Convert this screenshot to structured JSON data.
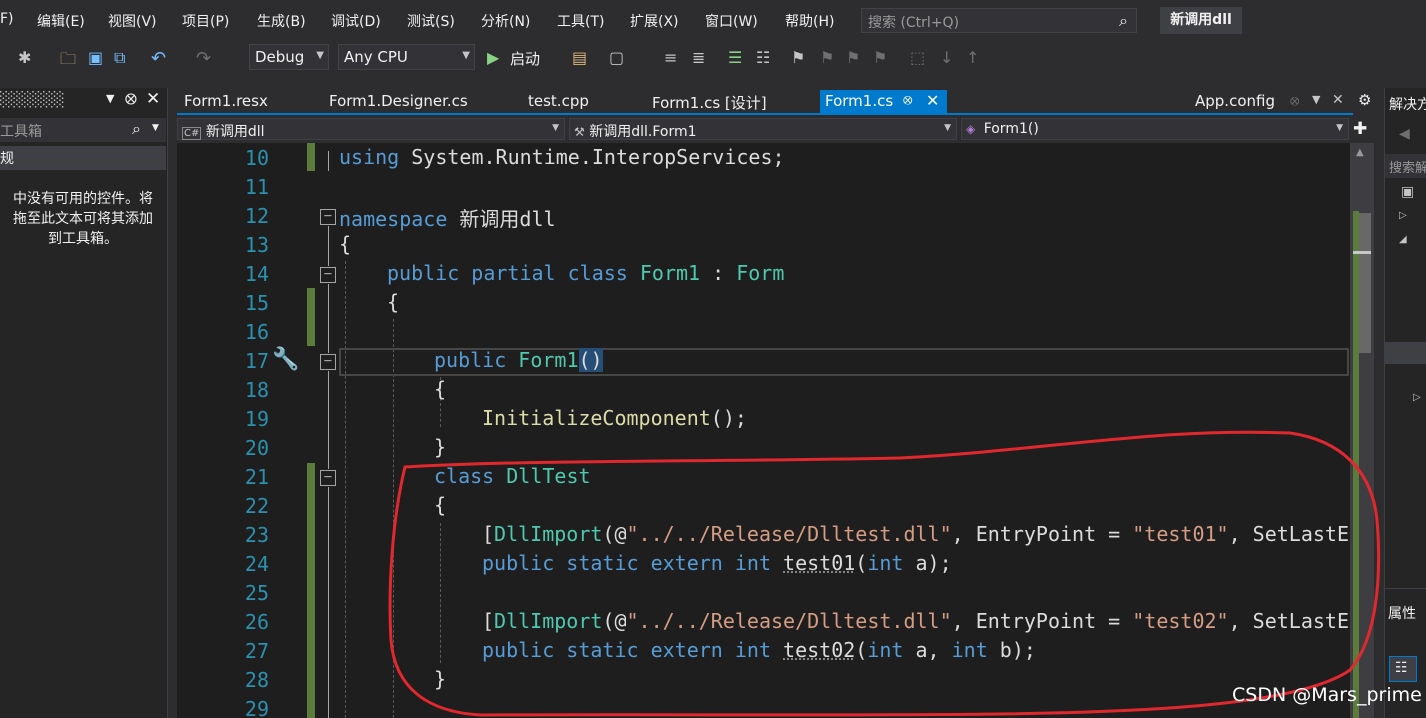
{
  "menu": {
    "items": [
      "F)",
      "编辑(E)",
      "视图(V)",
      "项目(P)",
      "生成(B)",
      "调试(D)",
      "测试(S)",
      "分析(N)",
      "工具(T)",
      "扩展(X)",
      "窗口(W)",
      "帮助(H)"
    ],
    "search_placeholder": "搜索 (Ctrl+Q)",
    "project_title": "新调用dll"
  },
  "toolbar": {
    "config": "Debug",
    "platform": "Any CPU",
    "start_label": "启动"
  },
  "toolbox": {
    "search_placeholder": "工具箱",
    "selected_item": "规",
    "message_lines": [
      "中没有可用的控件。将",
      "拖至此文本可将其添加",
      "到工具箱。"
    ]
  },
  "tabs": {
    "items": [
      "Form1.resx",
      "Form1.Designer.cs",
      "test.cpp",
      "Form1.cs [设计]",
      "Form1.cs",
      "App.config"
    ],
    "active": "Form1.cs"
  },
  "navbar": {
    "project": "新调用dll",
    "class": "新调用dll.Form1",
    "member": "Form1()"
  },
  "code": {
    "line_numbers": [
      "10",
      "11",
      "12",
      "13",
      "14",
      "15",
      "16",
      "17",
      "18",
      "19",
      "20",
      "21",
      "22",
      "23",
      "24",
      "25",
      "26",
      "27",
      "28",
      "29"
    ],
    "lines": {
      "l10": {
        "kw": "using",
        "rest": " System.Runtime.InteropServices;"
      },
      "l12": {
        "kw": "namespace",
        "rest": " 新调用dll"
      },
      "l13": {
        "text": "{"
      },
      "l14": {
        "kw": "public partial class",
        "type1": "Form1",
        "sep": " : ",
        "type2": "Form"
      },
      "l15": {
        "text": "{"
      },
      "l17": {
        "kw": "public",
        "type": "Form1",
        "paren": "()"
      },
      "l18": {
        "text": "{"
      },
      "l19": {
        "fn": "InitializeComponent",
        "rest": "();"
      },
      "l20": {
        "text": "}"
      },
      "l21": {
        "kw": "class",
        "type": "DllTest"
      },
      "l22": {
        "text": "{"
      },
      "l23": {
        "open": "[",
        "attr": "DllImport",
        "p1": "(@",
        "path": "\"../../Release/Dlltest.dll\"",
        "p2": ", EntryPoint = ",
        "entry": "\"test01\"",
        "p3": ", SetLastErr"
      },
      "l24": {
        "kw": "public static extern int",
        "name": "test01",
        "p1": "(",
        "kw2": "int",
        "rest": " a);"
      },
      "l26": {
        "open": "[",
        "attr": "DllImport",
        "p1": "(@",
        "path": "\"../../Release/Dlltest.dll\"",
        "p2": ", EntryPoint = ",
        "entry": "\"test02\"",
        "p3": ", SetLastErr"
      },
      "l27": {
        "kw": "public static extern int",
        "name": "test02",
        "p1": "(",
        "kw2": "int",
        "mid": " a, ",
        "kw3": "int",
        "rest": " b);"
      },
      "l28": {
        "text": "}"
      }
    }
  },
  "solution_explorer": {
    "title": "解决方",
    "search_placeholder": "搜索解",
    "properties_title": "属性"
  },
  "watermark": "CSDN @Mars_prime",
  "colors": {
    "keyword": "#569cd6",
    "type": "#4ec9b0",
    "string": "#d69d85",
    "method": "#dcdcaa",
    "line_number": "#2b91af",
    "accent": "#007acc",
    "annotation": "#e0282e"
  }
}
